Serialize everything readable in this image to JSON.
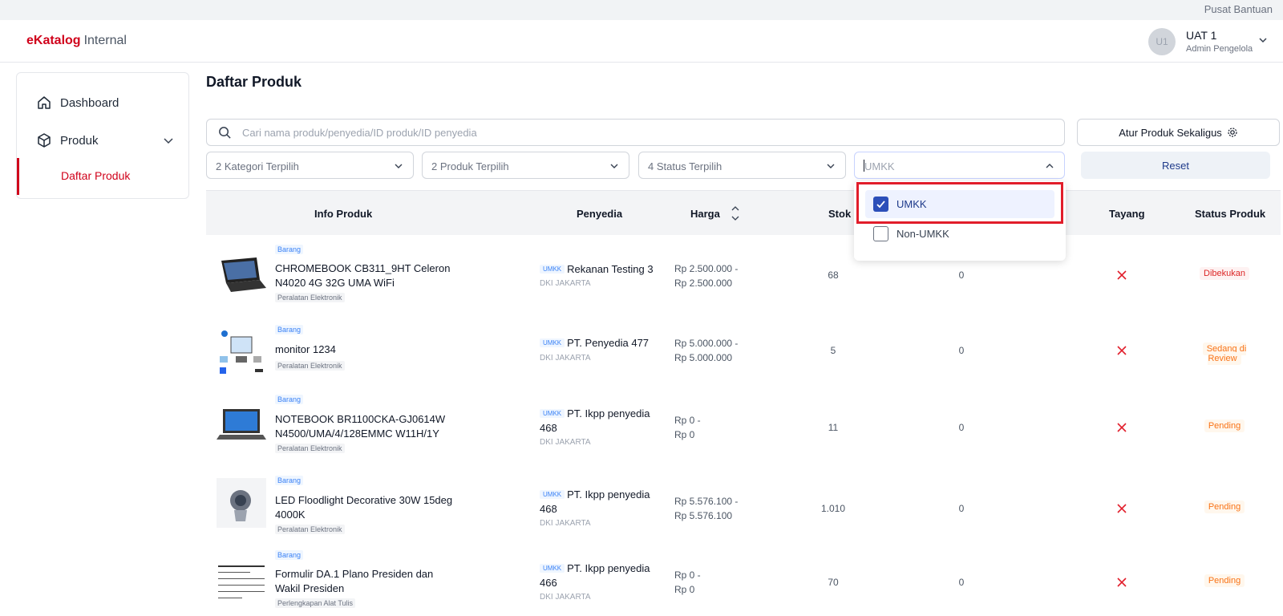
{
  "topbar": {
    "help_link": "Pusat Bantuan"
  },
  "header": {
    "logo_brand": "eKatalog",
    "logo_suffix": "Internal",
    "user": {
      "initials": "U1",
      "name": "UAT 1",
      "role": "Admin Pengelola"
    }
  },
  "sidebar": {
    "items": [
      {
        "label": "Dashboard",
        "icon": "home-icon"
      },
      {
        "label": "Produk",
        "icon": "box-icon"
      }
    ],
    "sub_items": [
      {
        "label": "Daftar Produk",
        "active": true
      }
    ]
  },
  "page": {
    "title": "Daftar Produk"
  },
  "search": {
    "placeholder": "Cari nama produk/penyedia/ID produk/ID penyedia",
    "value": ""
  },
  "actions": {
    "bulk_label": "Atur Produk Sekaligus",
    "reset_label": "Reset"
  },
  "filters": {
    "kategori": "2 Kategori Terpilih",
    "produk": "2 Produk Terpilih",
    "status": "4 Status Terpilih",
    "umkk_placeholder": "UMKK"
  },
  "umkk_dropdown": {
    "options": [
      {
        "label": "UMKK",
        "checked": true
      },
      {
        "label": "Non-UMKK",
        "checked": false
      }
    ]
  },
  "table": {
    "headers": {
      "info": "Info Produk",
      "penyedia": "Penyedia",
      "harga": "Harga",
      "stok": "Stok",
      "tayang": "Tayang",
      "status": "Status Produk"
    },
    "rows": [
      {
        "type": "Barang",
        "name": "CHROMEBOOK CB311_9HT Celeron N4020 4G 32G UMA WiFi",
        "category": "Peralatan Elektronik",
        "seller_badge": "UMKK",
        "seller": "Rekanan Testing 3",
        "region": "DKI JAKARTA",
        "price_min": "Rp 2.500.000 -",
        "price_max": "Rp 2.500.000",
        "stock": "68",
        "sold": "0",
        "status": "Dibekukan"
      },
      {
        "type": "Barang",
        "name": "monitor 1234",
        "category": "Peralatan Elektronik",
        "seller_badge": "UMKK",
        "seller": "PT. Penyedia 477",
        "region": "DKI JAKARTA",
        "price_min": "Rp 5.000.000 -",
        "price_max": "Rp 5.000.000",
        "stock": "5",
        "sold": "0",
        "status": "Sedang di Review"
      },
      {
        "type": "Barang",
        "name": "NOTEBOOK BR1100CKA-GJ0614W N4500/UMA/4/128EMMC W11H/1Y",
        "category": "Peralatan Elektronik",
        "seller_badge": "UMKK",
        "seller": "PT. Ikpp penyedia 468",
        "region": "DKI JAKARTA",
        "price_min": "Rp 0 -",
        "price_max": "Rp 0",
        "stock": "11",
        "sold": "0",
        "status": "Pending"
      },
      {
        "type": "Barang",
        "name": "LED Floodlight Decorative 30W 15deg 4000K",
        "category": "Peralatan Elektronik",
        "seller_badge": "UMKK",
        "seller": "PT. Ikpp penyedia 468",
        "region": "DKI JAKARTA",
        "price_min": "Rp 5.576.100 -",
        "price_max": "Rp 5.576.100",
        "stock": "1.010",
        "sold": "0",
        "status": "Pending"
      },
      {
        "type": "Barang",
        "name": "Formulir DA.1 Plano Presiden dan Wakil Presiden",
        "category": "Perlengkapan Alat Tulis",
        "seller_badge": "UMKK",
        "seller": "PT. Ikpp penyedia 466",
        "region": "DKI JAKARTA",
        "price_min": "Rp 0 -",
        "price_max": "Rp 0",
        "stock": "70",
        "sold": "0",
        "status": "Pending"
      }
    ]
  },
  "colors": {
    "brand": "#d0021b",
    "primary": "#2c4fb9",
    "status_red": "#dc2626",
    "status_orange": "#f97316"
  }
}
